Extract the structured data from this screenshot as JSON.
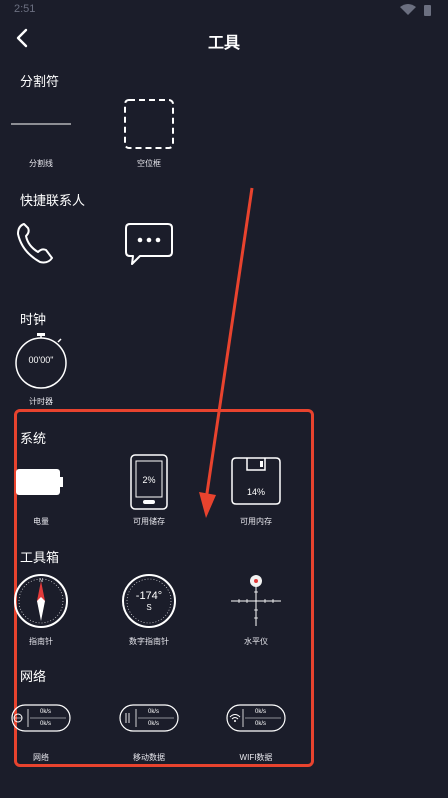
{
  "status_bar": {
    "time": "2:51"
  },
  "header": {
    "title": "工具"
  },
  "sections": {
    "divider": {
      "title": "分割符",
      "items": [
        {
          "label": "分割线"
        },
        {
          "label": "空位框"
        }
      ]
    },
    "contacts": {
      "title": "快捷联系人"
    },
    "clock": {
      "title": "时钟",
      "timer": {
        "label": "计时器",
        "display": "00'00\""
      }
    },
    "system": {
      "title": "系统",
      "items": [
        {
          "label": "电量"
        },
        {
          "label": "可用储存",
          "value": "2%"
        },
        {
          "label": "可用内存",
          "value": "14%"
        }
      ]
    },
    "toolbox": {
      "title": "工具箱",
      "items": [
        {
          "label": "指南针"
        },
        {
          "label": "数字指南针",
          "degree": "-174°",
          "direction": "S"
        },
        {
          "label": "水平仪"
        }
      ]
    },
    "network": {
      "title": "网络",
      "items": [
        {
          "label": "网络",
          "up": "0k/s",
          "down": "0k/s"
        },
        {
          "label": "移动数据",
          "up": "0k/s",
          "down": "0k/s"
        },
        {
          "label": "WIFI数据",
          "up": "0k/s",
          "down": "0k/s"
        }
      ]
    }
  },
  "colors": {
    "background": "#1b1d2a",
    "annotation": "#e8432e",
    "text": "#ffffff",
    "compass_needle": "#e23a3a"
  }
}
